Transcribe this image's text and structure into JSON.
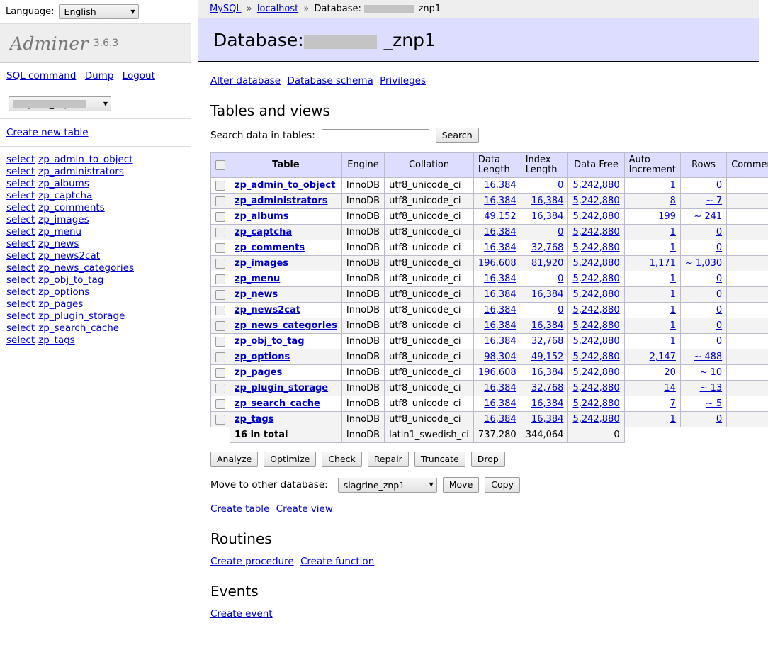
{
  "sidebar": {
    "language_label": "Language:",
    "language_value": "English",
    "brand": "Adminer",
    "version": "3.6.3",
    "nav_links": [
      {
        "label": "SQL command"
      },
      {
        "label": "Dump"
      },
      {
        "label": "Logout"
      }
    ],
    "db_select_value": "siagrine_znp1",
    "create_new_table": "Create new table",
    "select_label": "select",
    "tables": [
      "zp_admin_to_object",
      "zp_administrators",
      "zp_albums",
      "zp_captcha",
      "zp_comments",
      "zp_images",
      "zp_menu",
      "zp_news",
      "zp_news2cat",
      "zp_news_categories",
      "zp_obj_to_tag",
      "zp_options",
      "zp_pages",
      "zp_plugin_storage",
      "zp_search_cache",
      "zp_tags"
    ]
  },
  "breadcrumb": {
    "server": "MySQL",
    "host": "localhost",
    "db_prefix": "Database:",
    "db_name_visible": "_znp1",
    "separator": "»"
  },
  "header": {
    "title_prefix": "Database:",
    "title_db_visible": "_znp1"
  },
  "db_actions": [
    {
      "label": "Alter database"
    },
    {
      "label": "Database schema"
    },
    {
      "label": "Privileges"
    }
  ],
  "tables_section": {
    "heading": "Tables and views",
    "search_label": "Search data in tables:",
    "search_value": "",
    "search_placeholder": "",
    "search_button": "Search",
    "columns": [
      "Table",
      "Engine",
      "Collation",
      "Data Length",
      "Index Length",
      "Data Free",
      "Auto Increment",
      "Rows",
      "Comment"
    ],
    "rows": [
      {
        "name": "zp_admin_to_object",
        "engine": "InnoDB",
        "collation": "utf8_unicode_ci",
        "data_length": "16,384",
        "index_length": "0",
        "data_free": "5,242,880",
        "auto_increment": "1",
        "rows": "0",
        "comment": ""
      },
      {
        "name": "zp_administrators",
        "engine": "InnoDB",
        "collation": "utf8_unicode_ci",
        "data_length": "16,384",
        "index_length": "16,384",
        "data_free": "5,242,880",
        "auto_increment": "8",
        "rows": "~ 7",
        "comment": ""
      },
      {
        "name": "zp_albums",
        "engine": "InnoDB",
        "collation": "utf8_unicode_ci",
        "data_length": "49,152",
        "index_length": "16,384",
        "data_free": "5,242,880",
        "auto_increment": "199",
        "rows": "~ 241",
        "comment": ""
      },
      {
        "name": "zp_captcha",
        "engine": "InnoDB",
        "collation": "utf8_unicode_ci",
        "data_length": "16,384",
        "index_length": "0",
        "data_free": "5,242,880",
        "auto_increment": "1",
        "rows": "0",
        "comment": ""
      },
      {
        "name": "zp_comments",
        "engine": "InnoDB",
        "collation": "utf8_unicode_ci",
        "data_length": "16,384",
        "index_length": "32,768",
        "data_free": "5,242,880",
        "auto_increment": "1",
        "rows": "0",
        "comment": ""
      },
      {
        "name": "zp_images",
        "engine": "InnoDB",
        "collation": "utf8_unicode_ci",
        "data_length": "196,608",
        "index_length": "81,920",
        "data_free": "5,242,880",
        "auto_increment": "1,171",
        "rows": "~ 1,030",
        "comment": ""
      },
      {
        "name": "zp_menu",
        "engine": "InnoDB",
        "collation": "utf8_unicode_ci",
        "data_length": "16,384",
        "index_length": "0",
        "data_free": "5,242,880",
        "auto_increment": "1",
        "rows": "0",
        "comment": ""
      },
      {
        "name": "zp_news",
        "engine": "InnoDB",
        "collation": "utf8_unicode_ci",
        "data_length": "16,384",
        "index_length": "16,384",
        "data_free": "5,242,880",
        "auto_increment": "1",
        "rows": "0",
        "comment": ""
      },
      {
        "name": "zp_news2cat",
        "engine": "InnoDB",
        "collation": "utf8_unicode_ci",
        "data_length": "16,384",
        "index_length": "0",
        "data_free": "5,242,880",
        "auto_increment": "1",
        "rows": "0",
        "comment": ""
      },
      {
        "name": "zp_news_categories",
        "engine": "InnoDB",
        "collation": "utf8_unicode_ci",
        "data_length": "16,384",
        "index_length": "16,384",
        "data_free": "5,242,880",
        "auto_increment": "1",
        "rows": "0",
        "comment": ""
      },
      {
        "name": "zp_obj_to_tag",
        "engine": "InnoDB",
        "collation": "utf8_unicode_ci",
        "data_length": "16,384",
        "index_length": "32,768",
        "data_free": "5,242,880",
        "auto_increment": "1",
        "rows": "0",
        "comment": ""
      },
      {
        "name": "zp_options",
        "engine": "InnoDB",
        "collation": "utf8_unicode_ci",
        "data_length": "98,304",
        "index_length": "49,152",
        "data_free": "5,242,880",
        "auto_increment": "2,147",
        "rows": "~ 488",
        "comment": ""
      },
      {
        "name": "zp_pages",
        "engine": "InnoDB",
        "collation": "utf8_unicode_ci",
        "data_length": "196,608",
        "index_length": "16,384",
        "data_free": "5,242,880",
        "auto_increment": "20",
        "rows": "~ 10",
        "comment": ""
      },
      {
        "name": "zp_plugin_storage",
        "engine": "InnoDB",
        "collation": "utf8_unicode_ci",
        "data_length": "16,384",
        "index_length": "32,768",
        "data_free": "5,242,880",
        "auto_increment": "14",
        "rows": "~ 13",
        "comment": ""
      },
      {
        "name": "zp_search_cache",
        "engine": "InnoDB",
        "collation": "utf8_unicode_ci",
        "data_length": "16,384",
        "index_length": "16,384",
        "data_free": "5,242,880",
        "auto_increment": "7",
        "rows": "~ 5",
        "comment": ""
      },
      {
        "name": "zp_tags",
        "engine": "InnoDB",
        "collation": "utf8_unicode_ci",
        "data_length": "16,384",
        "index_length": "16,384",
        "data_free": "5,242,880",
        "auto_increment": "1",
        "rows": "0",
        "comment": ""
      }
    ],
    "total": {
      "label": "16 in total",
      "engine": "InnoDB",
      "collation": "latin1_swedish_ci",
      "data_length": "737,280",
      "index_length": "344,064",
      "data_free": "0"
    },
    "action_buttons": [
      {
        "label": "Analyze"
      },
      {
        "label": "Optimize"
      },
      {
        "label": "Check"
      },
      {
        "label": "Repair"
      },
      {
        "label": "Truncate"
      },
      {
        "label": "Drop"
      }
    ],
    "move_label": "Move to other database:",
    "move_select_value": "siagrine_znp1",
    "move_button": "Move",
    "copy_button": "Copy",
    "create_table": "Create table",
    "create_view": "Create view"
  },
  "routines": {
    "heading": "Routines",
    "create_procedure": "Create procedure",
    "create_function": "Create function"
  },
  "events": {
    "heading": "Events",
    "create_event": "Create event"
  },
  "colors": {
    "header_bg": "#ddddff",
    "breadcrumb_bg": "#eeeeee",
    "link": "#0000cc",
    "redaction": "#c4c4c4",
    "row_alt": "#f3f3f3"
  }
}
